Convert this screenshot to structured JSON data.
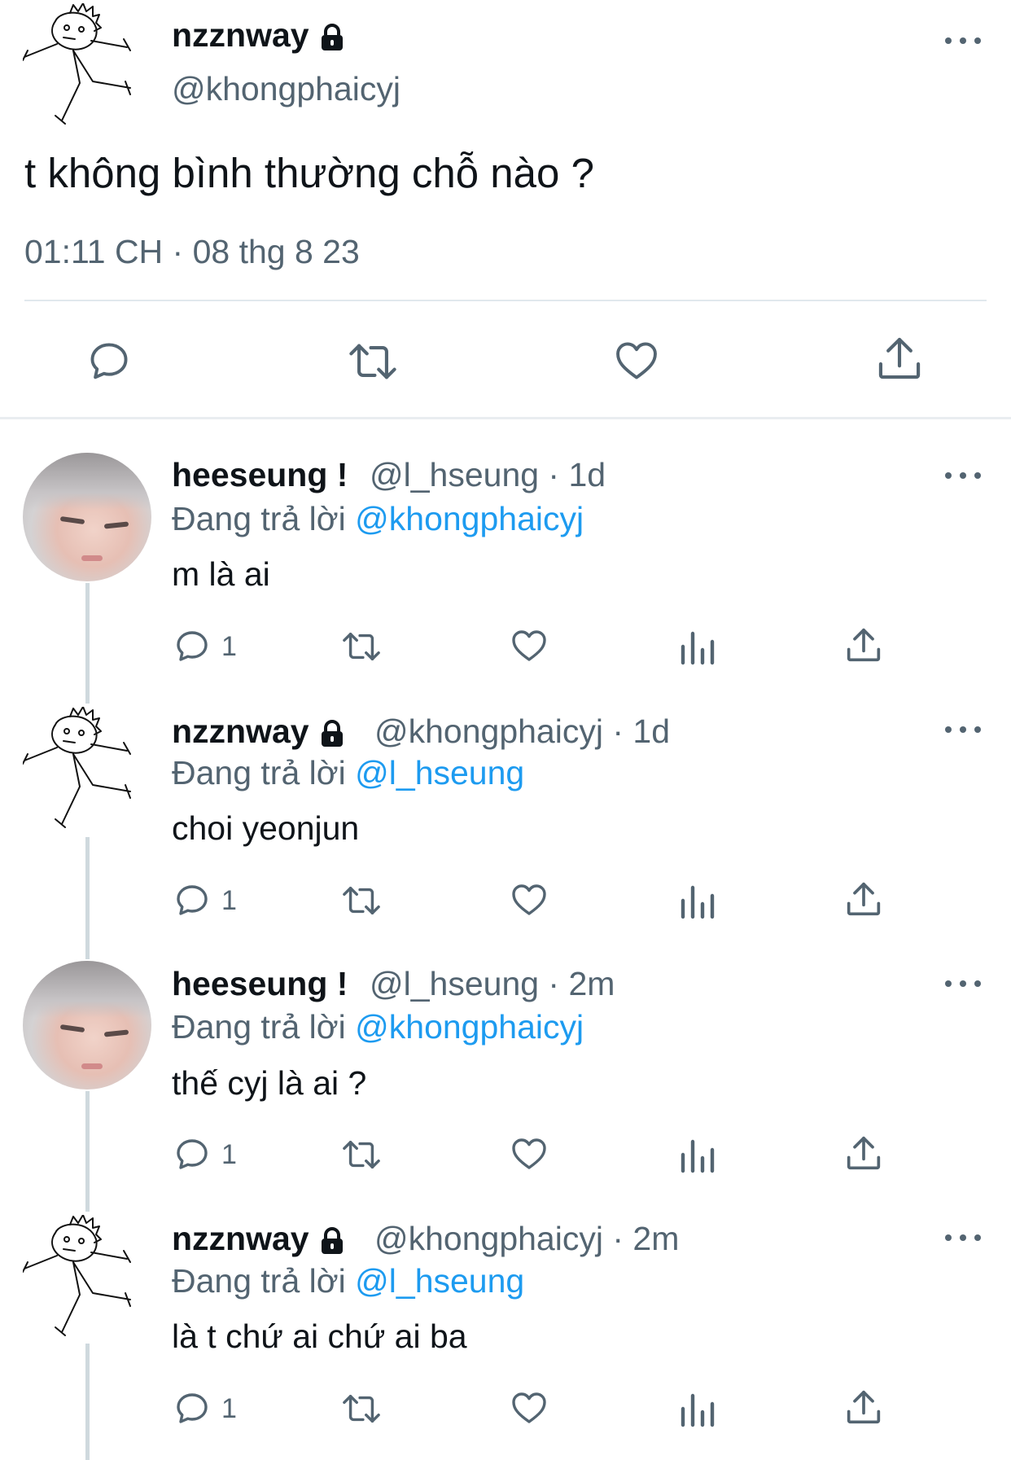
{
  "main_tweet": {
    "display_name": "nzznway",
    "handle": "@khongphaicyj",
    "text": "t không bình thường chỗ nào ?",
    "timestamp": "01:11 CH · 08 thg 8 23"
  },
  "replies": [
    {
      "display_name": "heeseung !",
      "meta": "@l_hseung · 1d",
      "replying_prefix": "Đang trả lời",
      "replying_to": "@khongphaicyj",
      "text": "m là ai",
      "reply_count": "1",
      "avatar": "photo"
    },
    {
      "display_name": "nzznway",
      "meta": "@khongphaicyj · 1d",
      "replying_prefix": "Đang trả lời",
      "replying_to": "@l_hseung",
      "text": "choi yeonjun",
      "reply_count": "1",
      "avatar": "doodle"
    },
    {
      "display_name": "heeseung !",
      "meta": "@l_hseung · 2m",
      "replying_prefix": "Đang trả lời",
      "replying_to": "@khongphaicyj",
      "text": "thế cyj là ai ?",
      "reply_count": "1",
      "avatar": "photo"
    },
    {
      "display_name": "nzznway",
      "meta": "@khongphaicyj · 2m",
      "replying_prefix": "Đang trả lời",
      "replying_to": "@l_hseung",
      "text": "là t chứ ai chứ ai ba",
      "reply_count": "1",
      "avatar": "doodle"
    }
  ],
  "icons": [
    "more-icon",
    "lock-icon",
    "reply-icon",
    "retweet-icon",
    "like-icon",
    "share-icon",
    "views-icon"
  ],
  "colors": {
    "link": "#1d9bf0",
    "muted": "#536471",
    "text": "#0f1419",
    "divider": "#e1e8ed",
    "thread_line": "#cfd9de"
  }
}
